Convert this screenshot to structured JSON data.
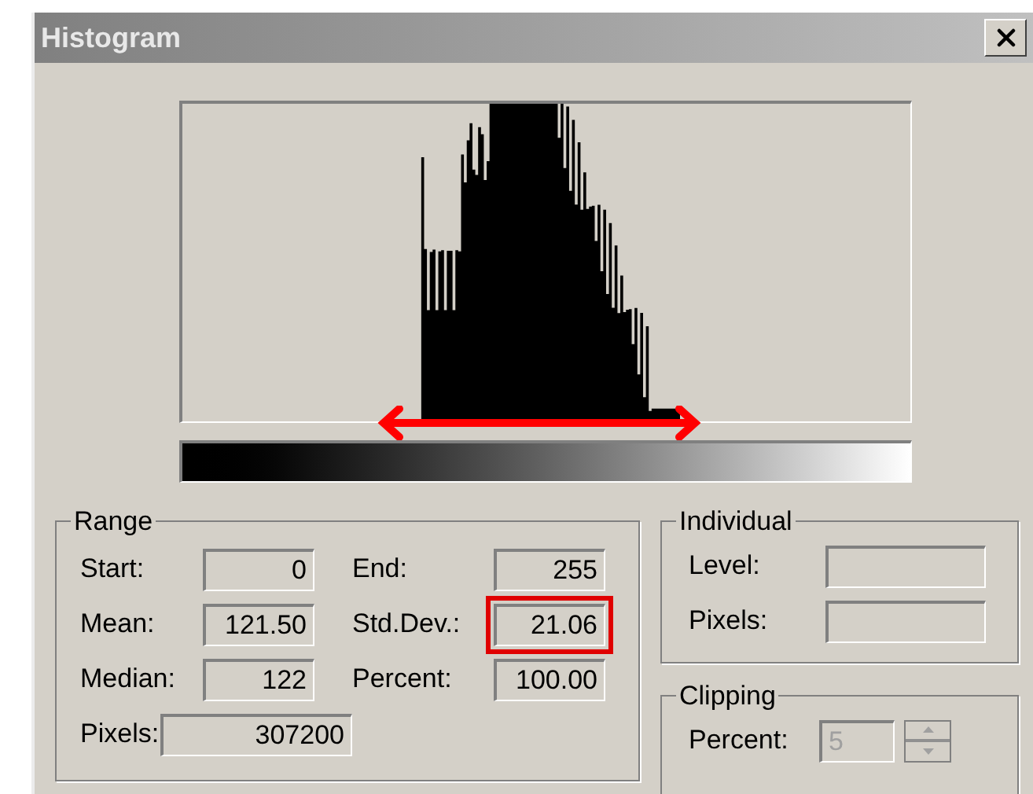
{
  "window": {
    "title": "Histogram"
  },
  "range": {
    "title": "Range",
    "rows": [
      {
        "cells": [
          {
            "label": "Start:",
            "value": "0",
            "highlighted": false
          },
          {
            "label": "End:",
            "value": "255",
            "highlighted": false
          }
        ]
      },
      {
        "cells": [
          {
            "label": "Mean:",
            "value": "121.50",
            "highlighted": false
          },
          {
            "label": "Std.Dev.:",
            "value": "21.06",
            "highlighted": true
          }
        ]
      },
      {
        "cells": [
          {
            "label": "Median:",
            "value": "122",
            "highlighted": false
          },
          {
            "label": "Percent:",
            "value": "100.00",
            "highlighted": false
          }
        ]
      },
      {
        "cells": [
          {
            "label": "Pixels:",
            "value": "307200",
            "highlighted": false,
            "kind": "wide"
          }
        ]
      }
    ]
  },
  "individual": {
    "title": "Individual",
    "fields": [
      {
        "label": "Level:"
      },
      {
        "label": "Pixels:"
      }
    ]
  },
  "clipping": {
    "title": "Clipping",
    "label": "Percent:",
    "value": "5",
    "disabled": true
  }
}
